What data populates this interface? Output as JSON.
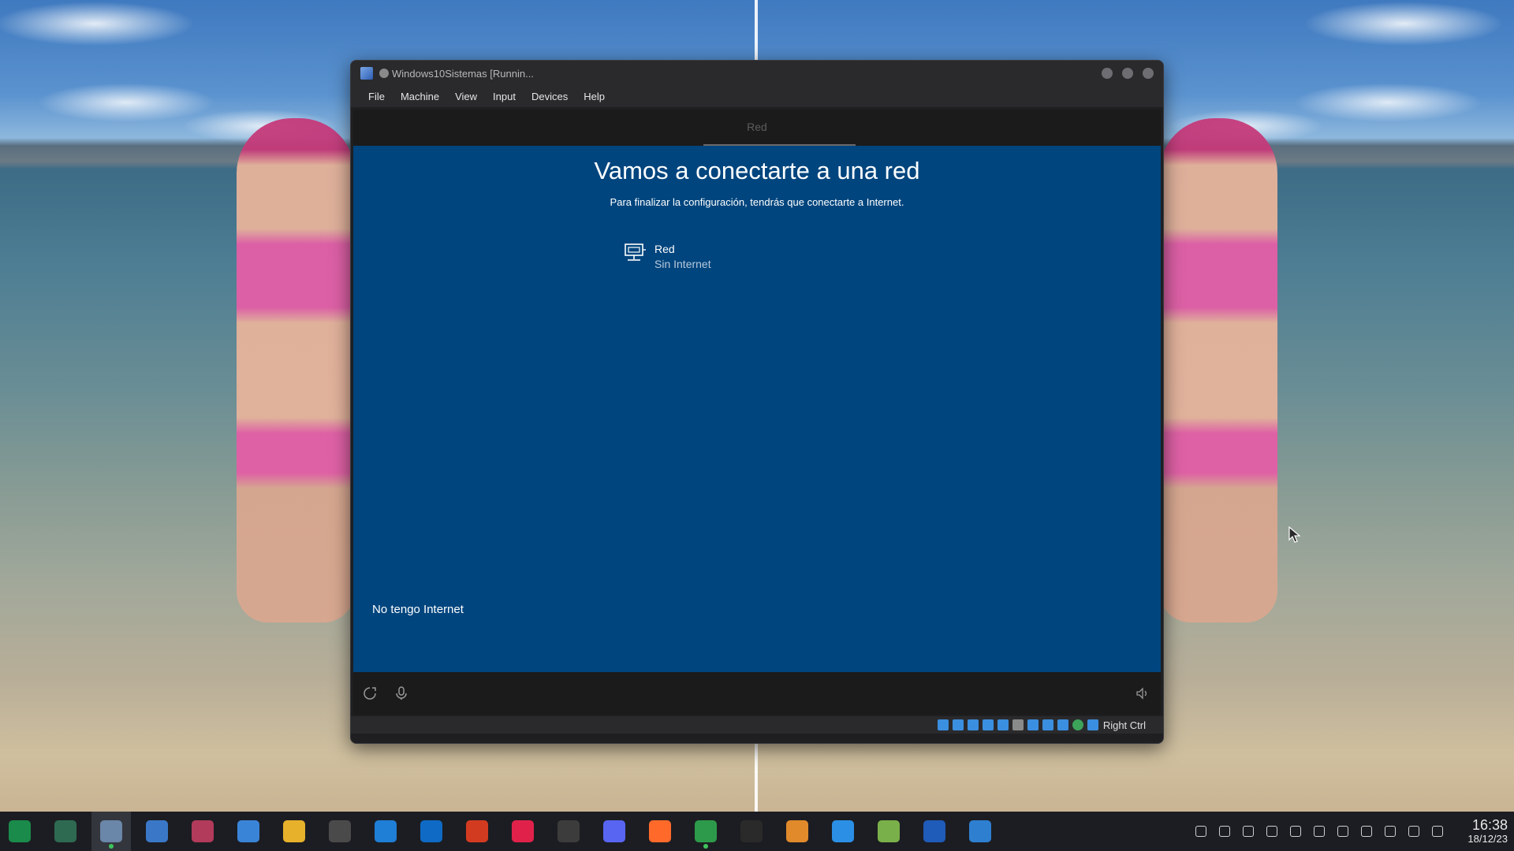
{
  "window": {
    "title": "Windows10Sistemas [Runnin..."
  },
  "menubar": {
    "items": [
      "File",
      "Machine",
      "View",
      "Input",
      "Devices",
      "Help"
    ]
  },
  "oobe": {
    "tab_label": "Red",
    "title": "Vamos a conectarte a una red",
    "subtitle": "Para finalizar la configuración, tendrás que conectarte a Internet.",
    "network": {
      "name": "Red",
      "status": "Sin Internet",
      "icon": "wired-network-icon"
    },
    "no_internet_link": "No tengo Internet",
    "footer_icons": [
      "accessibility-icon",
      "microphone-icon",
      "volume-icon"
    ]
  },
  "vm_statusbar": {
    "host_key": "Right Ctrl"
  },
  "taskbar": {
    "apps": [
      {
        "name": "app-launcher-icon",
        "color": "#1a8b4a"
      },
      {
        "name": "system-monitor-icon",
        "color": "#2e6a52"
      },
      {
        "name": "virtualbox-icon",
        "color": "#6a86a8",
        "active": true,
        "running": true
      },
      {
        "name": "store-icon",
        "color": "#3a78c7"
      },
      {
        "name": "media-player-icon",
        "color": "#b23a5a"
      },
      {
        "name": "notes-icon",
        "color": "#3a84d8"
      },
      {
        "name": "file-manager-icon",
        "color": "#e7b12c"
      },
      {
        "name": "inkscape-icon",
        "color": "#4a4a4a"
      },
      {
        "name": "files-icon",
        "color": "#1f7ed6"
      },
      {
        "name": "outlook-icon",
        "color": "#0e6ac4"
      },
      {
        "name": "office-icon",
        "color": "#d33b21"
      },
      {
        "name": "youtube-music-icon",
        "color": "#e0224b"
      },
      {
        "name": "obs-icon",
        "color": "#3c3c3c"
      },
      {
        "name": "discord-icon",
        "color": "#5865f2"
      },
      {
        "name": "firefox-icon",
        "color": "#ff6a2b"
      },
      {
        "name": "chrome-icon",
        "color": "#2c9a4a",
        "running": true
      },
      {
        "name": "terminal-icon",
        "color": "#2a2a2a"
      },
      {
        "name": "package-manager-icon",
        "color": "#e08a2c"
      },
      {
        "name": "vscode-icon",
        "color": "#2b8fe6"
      },
      {
        "name": "3d-package-icon",
        "color": "#7ab04a"
      },
      {
        "name": "word-icon",
        "color": "#1f5bb8"
      },
      {
        "name": "photos-icon",
        "color": "#2e7fd0"
      }
    ]
  },
  "tray": {
    "icons": [
      "desktop-icon",
      "panel-icon",
      "chrome-tray-icon",
      "update-icon",
      "info-icon",
      "clipboard-icon",
      "location-icon",
      "volume-tray-icon",
      "microphone-tray-icon",
      "network-tray-icon",
      "expand-tray-icon"
    ],
    "time": "16:38",
    "date": "18/12/23"
  }
}
